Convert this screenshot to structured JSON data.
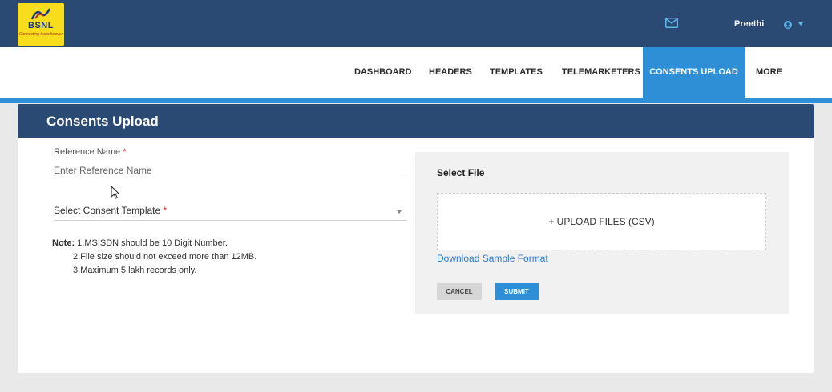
{
  "brand": {
    "logo_text": "BSNL",
    "tagline": "Connecting India forever"
  },
  "header": {
    "user_name": "Preethi"
  },
  "nav": {
    "items": [
      {
        "label": "DASHBOARD"
      },
      {
        "label": "HEADERS"
      },
      {
        "label": "TEMPLATES"
      },
      {
        "label": "TELEMARKETERS"
      },
      {
        "label": "CONSENTS UPLOAD",
        "active": true
      },
      {
        "label": "MORE"
      }
    ]
  },
  "page": {
    "title": "Consents Upload"
  },
  "form": {
    "reference_label": "Reference Name",
    "reference_placeholder": "Enter Reference Name",
    "required_mark": "*",
    "template_select_label": "Select Consent Template",
    "note_label": "Note:",
    "notes": [
      "1.MSISDN should be 10 Digit Number.",
      "2.File size should not exceed more than 12MB.",
      "3.Maximum 5 lakh records only."
    ]
  },
  "upload": {
    "title": "Select File",
    "dropzone_label": "+ UPLOAD FILES (CSV)",
    "download_link": "Download Sample Format",
    "cancel_label": "CANCEL",
    "submit_label": "SUBMIT"
  },
  "colors": {
    "header_bg": "#2b4a73",
    "accent": "#2f8fd6",
    "logo_bg": "#f7dd1c",
    "required": "#d9302c",
    "link": "#2f7cc4"
  },
  "icons": [
    "bsnl-logo-icon",
    "mail-icon",
    "user-circle-icon",
    "chevron-down-icon",
    "mouse-cursor-icon"
  ]
}
